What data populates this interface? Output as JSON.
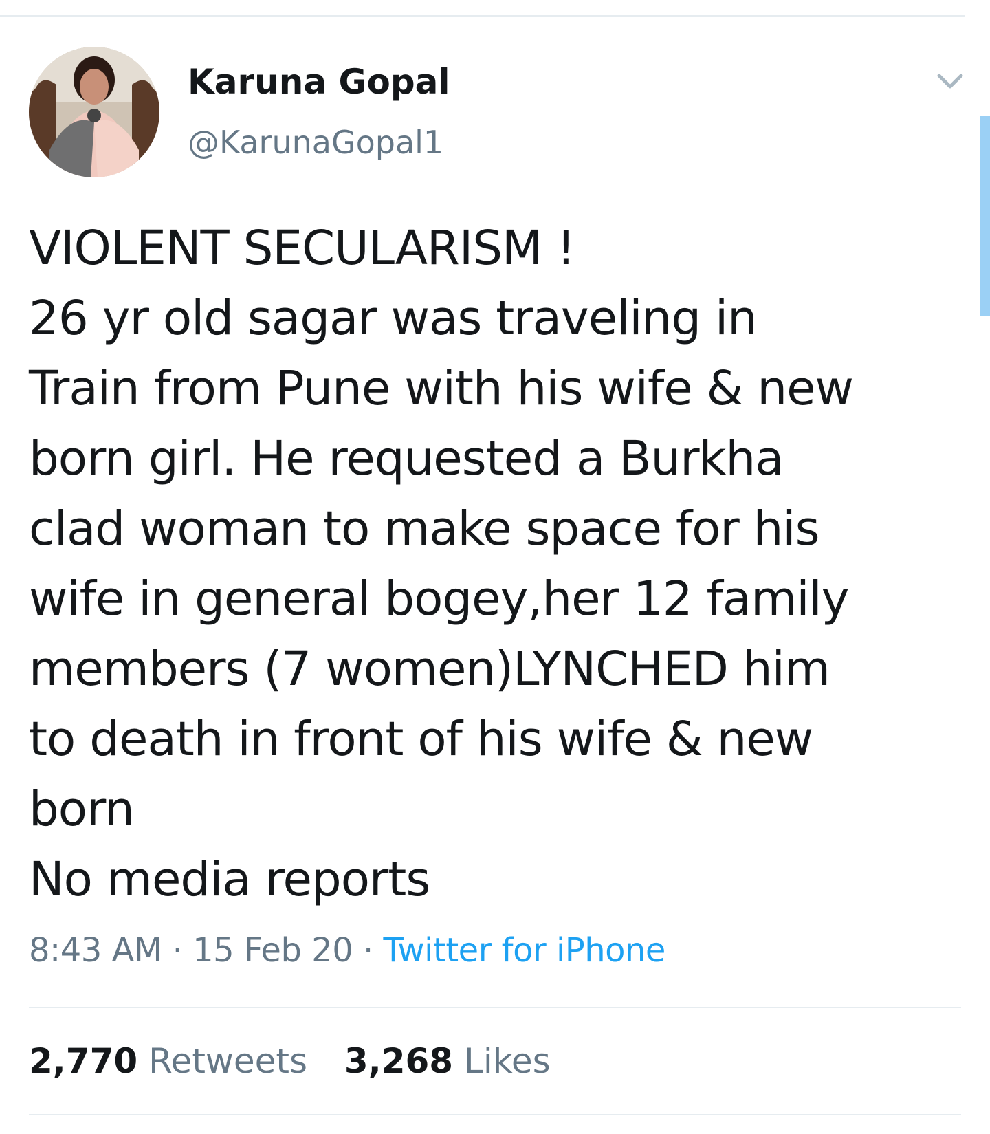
{
  "tweet": {
    "author": {
      "display_name": "Karuna Gopal",
      "handle": "@KarunaGopal1",
      "avatar_icon": "profile-photo"
    },
    "menu_icon": "chevron-down-icon",
    "text_lines": [
      "VIOLENT SECULARISM !",
      "26 yr old sagar was traveling in",
      "Train from Pune with his wife & new",
      "born girl. He requested a Burkha",
      "clad woman to make space for his",
      "wife in general bogey,her 12 family",
      "members (7 women)LYNCHED him",
      "to death in front of his wife & new",
      "born",
      "No media reports"
    ],
    "time": "8:43 AM",
    "date": "15 Feb 20",
    "separator": "·",
    "source": "Twitter for iPhone",
    "retweets": {
      "count": "2,770",
      "label": "Retweets"
    },
    "likes": {
      "count": "3,268",
      "label": "Likes"
    }
  },
  "colors": {
    "text": "#14171a",
    "secondary": "#657786",
    "link": "#1da1f2",
    "divider": "#e6ecf0",
    "scrollbar": "#9bd0f5"
  }
}
